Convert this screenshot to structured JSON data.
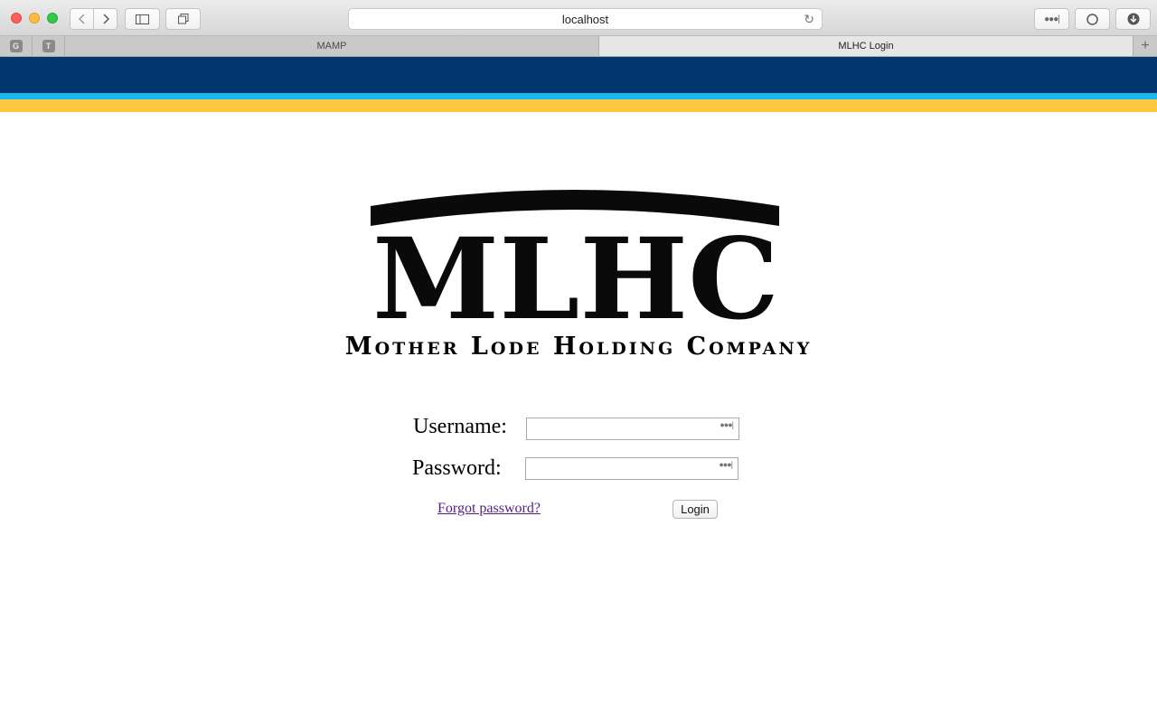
{
  "browser": {
    "address": "localhost",
    "tabs": [
      {
        "label": "MAMP",
        "active": false
      },
      {
        "label": "MLHC Login",
        "active": true
      }
    ],
    "pinned_tabs": [
      "G",
      "T"
    ]
  },
  "page": {
    "colors": {
      "navy": "#00386d",
      "blue": "#1ab7ef",
      "gold": "#fdc83f"
    },
    "logo": {
      "mark": "MLHC",
      "subtitle": "Mother Lode Holding Company"
    },
    "form": {
      "username_label": "Username:",
      "username_value": "",
      "password_label": "Password:",
      "password_value": "",
      "forgot_label": "Forgot password?",
      "login_label": "Login"
    }
  }
}
